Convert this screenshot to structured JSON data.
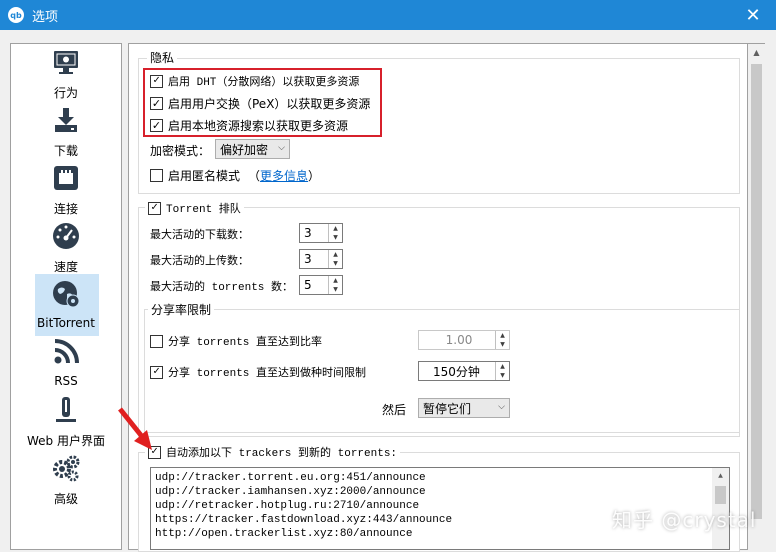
{
  "window": {
    "title": "选项",
    "app_icon": "qb",
    "icon": "qbittorrent-app-icon"
  },
  "sidebar": {
    "items": [
      {
        "label": "行为",
        "icon": "monitor-icon"
      },
      {
        "label": "下载",
        "icon": "download-icon"
      },
      {
        "label": "连接",
        "icon": "network-icon"
      },
      {
        "label": "速度",
        "icon": "speedometer-icon"
      },
      {
        "label": "BitTorrent",
        "icon": "bittorrent-globe-icon",
        "active": true
      },
      {
        "label": "RSS",
        "icon": "rss-icon"
      },
      {
        "label": "Web 用户界面",
        "icon": "web-ui-icon"
      },
      {
        "label": "高级",
        "icon": "gears-icon"
      }
    ]
  },
  "privacy": {
    "title": "隐私",
    "dht_label": "启用 DHT（分散网络）以获取更多资源",
    "dht_checked": true,
    "pex_label": "启用用户交换（PeX）以获取更多资源",
    "pex_checked": true,
    "lsd_label": "启用本地资源搜索以获取更多资源",
    "lsd_checked": true,
    "encryption_label": "加密模式：",
    "encryption_value": "偏好加密",
    "anonymous_label": "启用匿名模式",
    "anonymous_checked": false,
    "more_info_open": "（",
    "more_info_link": "更多信息",
    "more_info_close": "）"
  },
  "queueing": {
    "title": "Torrent 排队",
    "checked": true,
    "max_downloads_label": "最大活动的下载数：",
    "max_downloads_value": "3",
    "max_uploads_label": "最大活动的上传数：",
    "max_uploads_value": "3",
    "max_torrents_label": "最大活动的 torrents 数：",
    "max_torrents_value": "5"
  },
  "seeding": {
    "title": "分享率限制",
    "ratio_label": "分享 torrents 直至达到比率",
    "ratio_checked": false,
    "ratio_value": "1.00",
    "time_label": "分享 torrents 直至达到做种时间限制",
    "time_checked": true,
    "time_value": "150分钟",
    "then_label": "然后",
    "action_value": "暂停它们"
  },
  "trackers": {
    "label": "自动添加以下 trackers 到新的 torrents:",
    "checked": true,
    "list": [
      "udp://tracker.torrent.eu.org:451/announce",
      "udp://tracker.iamhansen.xyz:2000/announce",
      "udp://retracker.hotplug.ru:2710/announce",
      "https://tracker.fastdownload.xyz:443/announce",
      "http://open.trackerlist.xyz:80/announce"
    ]
  },
  "watermark": "知乎 @crystal",
  "colors": {
    "titlebar": "#1f87d6",
    "highlight_box": "#d7202b",
    "annotation_arrow": "#e02020",
    "link": "#0066cc",
    "selected_item": "#cce4f7"
  }
}
